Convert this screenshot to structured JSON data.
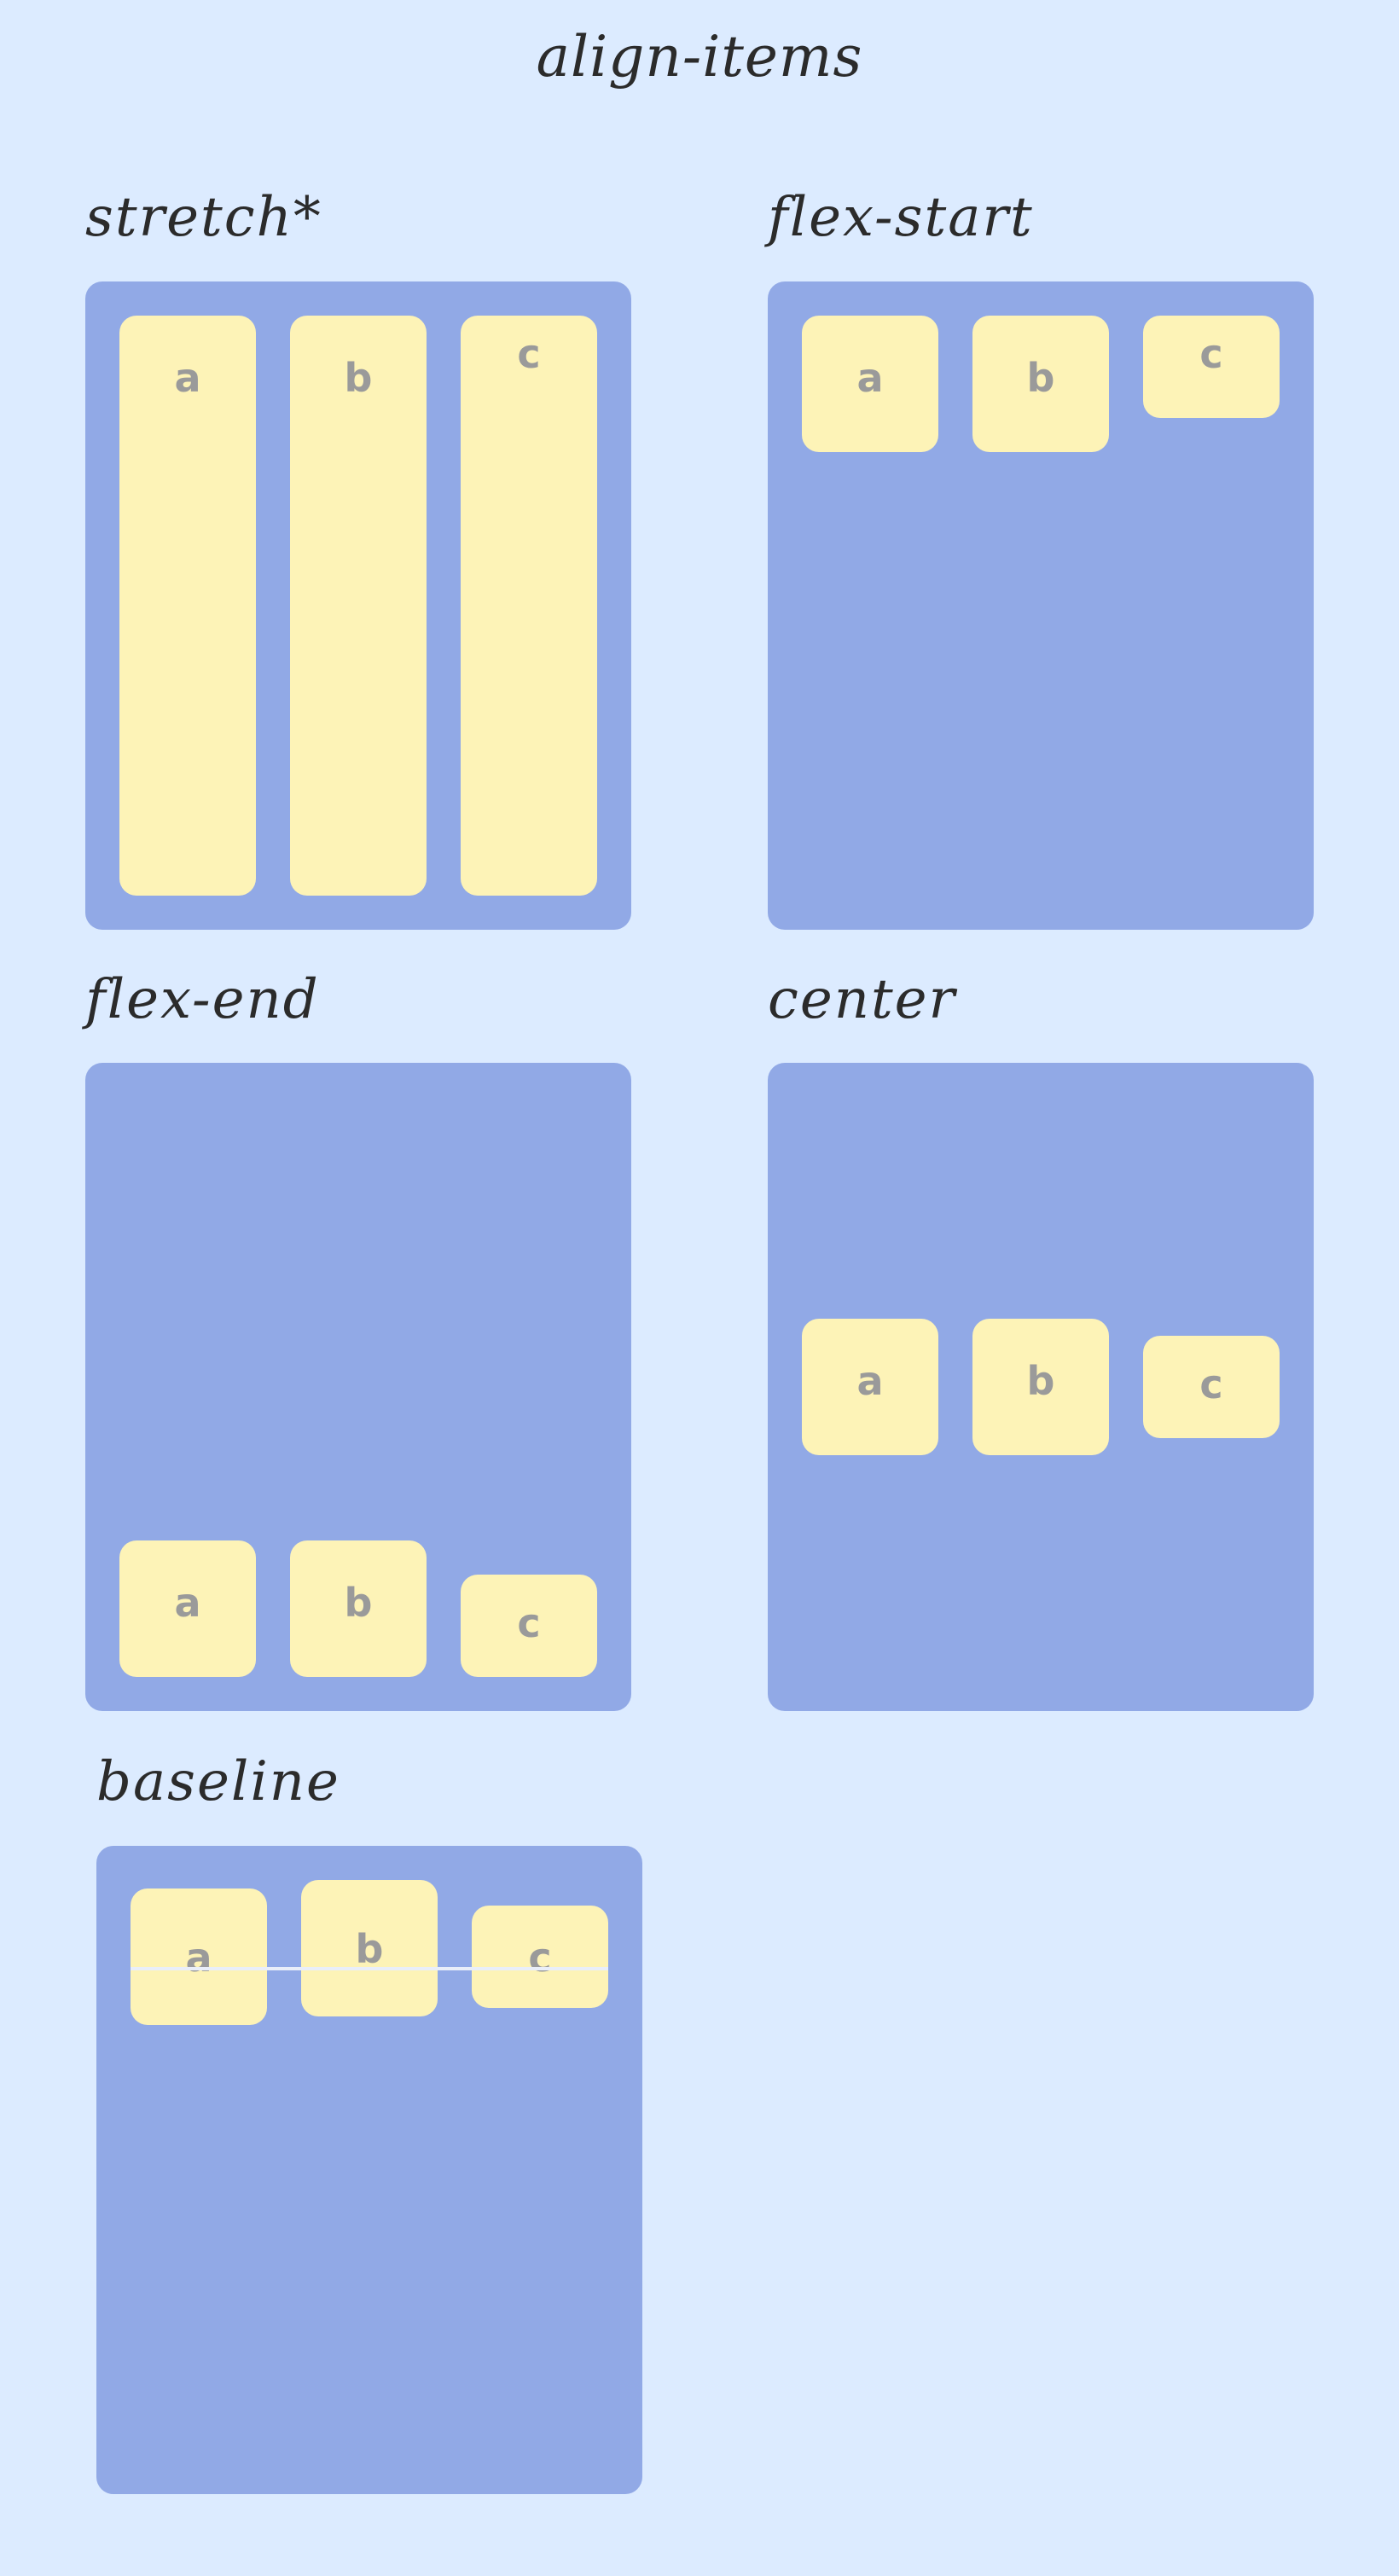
{
  "title": "align-items",
  "colors": {
    "page_background": "#dcebff",
    "container": "#91a9e6",
    "item": "#fdf3b7",
    "item_letter": "#9a9a9a",
    "heading": "#2b2b2b"
  },
  "panels": [
    {
      "label": "stretch*",
      "items": [
        "a",
        "b",
        "c"
      ]
    },
    {
      "label": "flex-start",
      "items": [
        "a",
        "b",
        "c"
      ]
    },
    {
      "label": "flex-end",
      "items": [
        "a",
        "b",
        "c"
      ]
    },
    {
      "label": "center",
      "items": [
        "a",
        "b",
        "c"
      ]
    },
    {
      "label": "baseline",
      "items": [
        "a",
        "b",
        "c"
      ]
    }
  ]
}
